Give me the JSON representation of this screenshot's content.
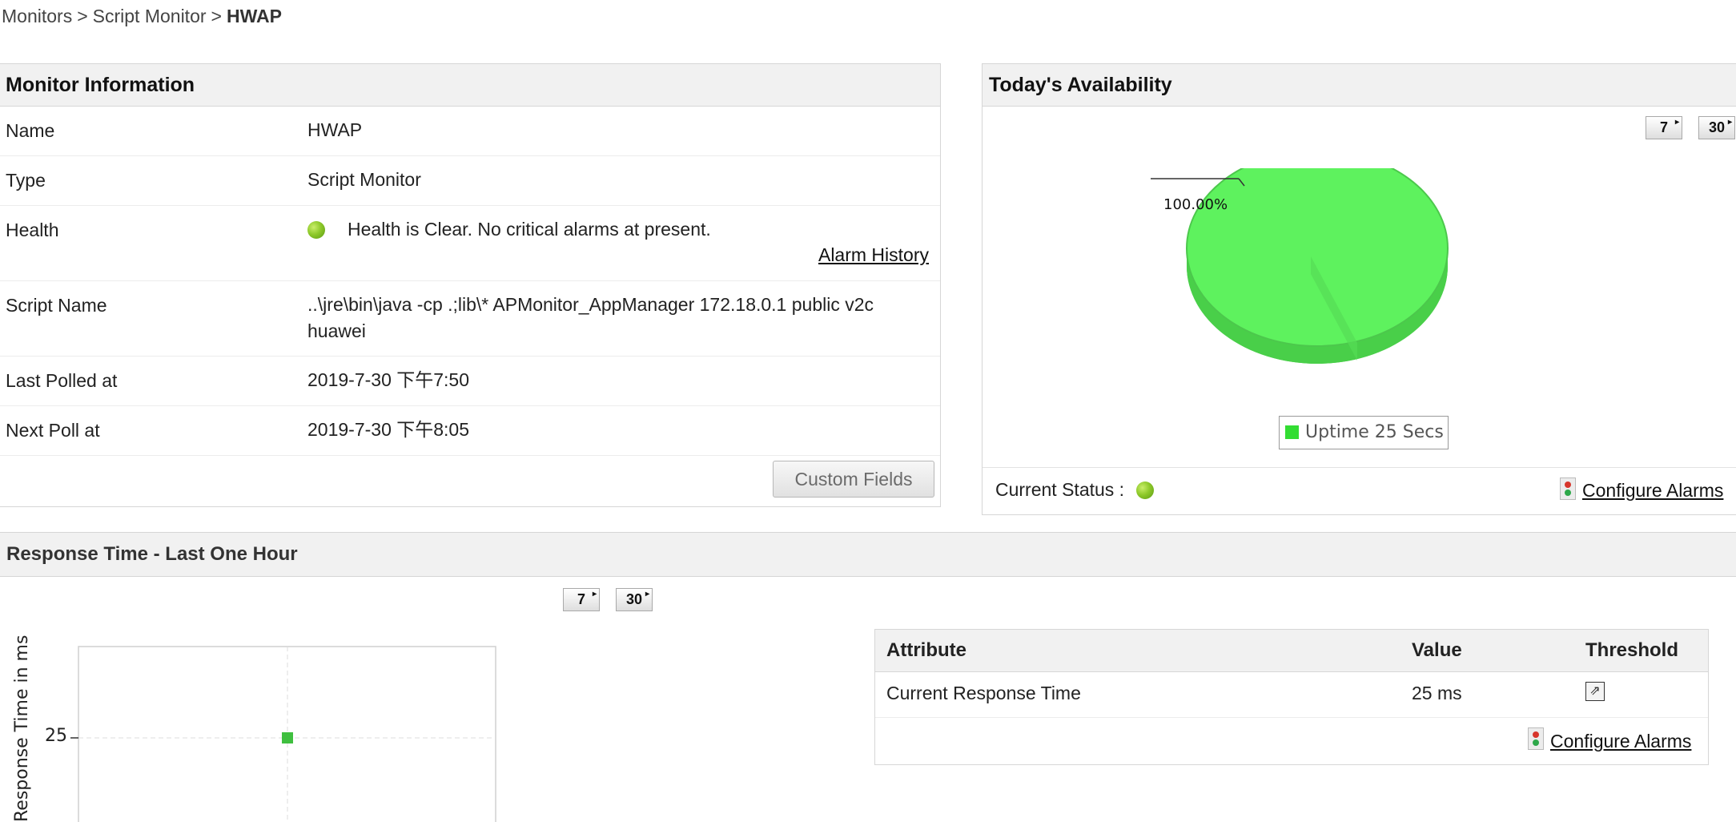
{
  "breadcrumb": {
    "items": [
      "Monitors",
      "Script Monitor"
    ],
    "separator": ">",
    "current": "HWAP"
  },
  "monitor_info": {
    "title": "Monitor Information",
    "rows": [
      {
        "label": "Name",
        "value": "HWAP"
      },
      {
        "label": "Type",
        "value": "Script Monitor"
      },
      {
        "label": "Health",
        "value": "Health is Clear. No critical alarms at present."
      },
      {
        "label": "Script Name",
        "value": "..\\jre\\bin\\java -cp .;lib\\* APMonitor_AppManager 172.18.0.1 public v2c huawei"
      },
      {
        "label": "Last Polled at",
        "value": "2019-7-30 下午7:50"
      },
      {
        "label": "Next Poll at",
        "value": "2019-7-30 下午8:05"
      }
    ],
    "alarm_history_link": "Alarm History",
    "custom_fields_button": "Custom Fields"
  },
  "availability": {
    "title": "Today's Availability",
    "period_buttons": [
      "7",
      "30"
    ],
    "current_status_label": "Current Status :",
    "configure_alarms": "Configure Alarms",
    "chart_data": {
      "type": "pie",
      "slices": [
        {
          "label": "Uptime",
          "value": 100.0,
          "color": "#5ef25e"
        }
      ],
      "data_label": "100.00%",
      "legend": [
        "Uptime 25 Secs"
      ],
      "legend_position": "bottom"
    }
  },
  "response": {
    "title": "Response Time - Last One Hour",
    "period_buttons": [
      "7",
      "30"
    ],
    "chart_data": {
      "type": "scatter",
      "ylabel": "Response Time in ms",
      "y_ticks": [
        "25"
      ],
      "series": [
        {
          "values": [
            25
          ],
          "color": "#3fbf3f"
        }
      ],
      "grid": true
    }
  },
  "attributes": {
    "headers": [
      "Attribute",
      "Value",
      "Threshold"
    ],
    "rows": [
      {
        "attribute": "Current Response Time",
        "value": "25 ms",
        "threshold_icon": "edit-threshold-icon"
      }
    ],
    "configure_alarms": "Configure Alarms"
  },
  "colors": {
    "status_green": "#8ec92a",
    "uptime_green": "#5ef25e",
    "panel_header": "#f1f1f1"
  }
}
